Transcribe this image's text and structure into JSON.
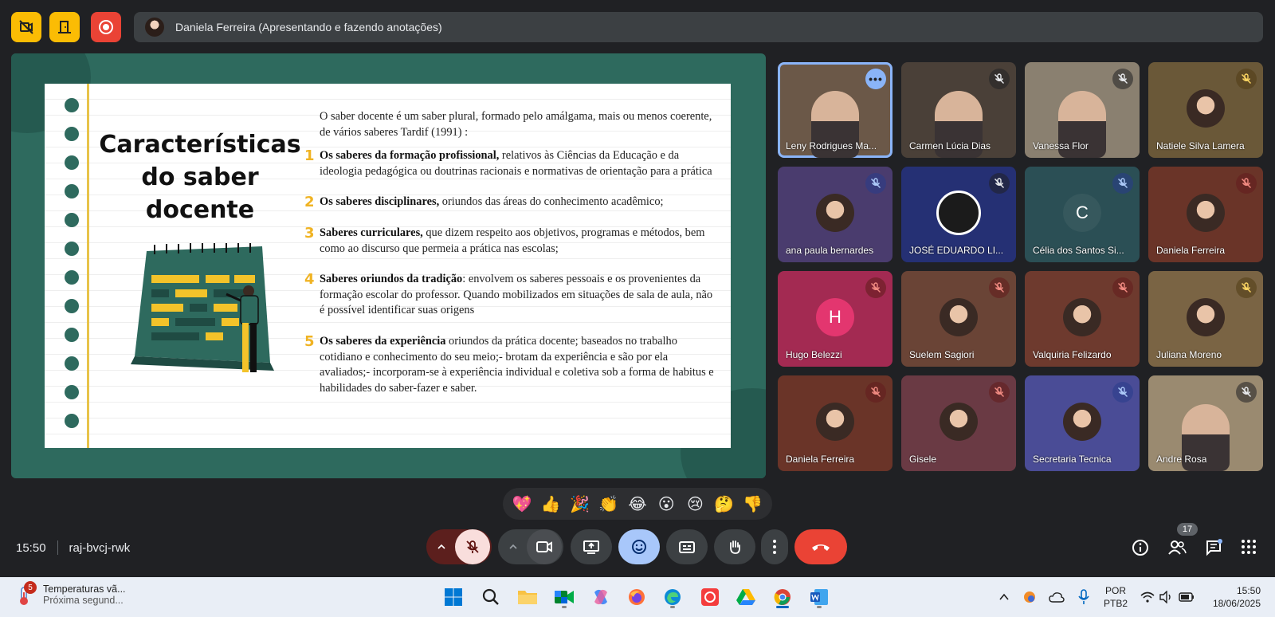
{
  "presenter_bar": {
    "label": "Daniela Ferreira (Apresentando e fazendo anotações)"
  },
  "slide": {
    "title_lines": [
      "Características",
      "do saber",
      "docente"
    ],
    "intro": "O saber docente é um saber plural, formado pelo amálgama, mais ou menos coerente, de vários saberes Tardif (1991) :",
    "items": [
      {
        "num": "1",
        "bold": "Os saberes da formação profissional,",
        "text": " relativos às Ciências da Educação e da ideologia pedagógica ou doutrinas racionais e normativas de orientação para a prática"
      },
      {
        "num": "2",
        "bold": "Os saberes disciplinares,",
        "text": " oriundos das áreas do conhecimento acadêmico;"
      },
      {
        "num": "3",
        "bold": " Saberes curriculares,",
        "text": " que dizem respeito aos objetivos, programas e métodos, bem como ao discurso que permeia a prática nas escolas;"
      },
      {
        "num": "4",
        "bold": "Saberes oriundos da tradição",
        "text": ": envolvem os saberes pessoais e os provenientes da formação escolar do professor. Quando mobilizados em situações de sala de aula, não é possível identificar suas origens"
      },
      {
        "num": "5",
        "bold": "Os saberes da experiência",
        "text": " oriundos da prática docente; baseados no trabalho cotidiano  e conhecimento do seu meio;- brotam da experiência e são por ela avaliados;- incorporam-se à experiência individual e coletiva sob a forma de habitus e habilidades do saber-fazer e saber."
      }
    ]
  },
  "participants": [
    {
      "name": "Leny Rodrigues Ma...",
      "bg": "#6b5848",
      "kind": "video",
      "mic": "more"
    },
    {
      "name": "Carmen Lúcia Dias",
      "bg": "#4a4038",
      "kind": "video",
      "mic": "dark"
    },
    {
      "name": "Vanessa Flor",
      "bg": "#8a8070",
      "kind": "video",
      "mic": "dark"
    },
    {
      "name": "Natiele Silva Lamera",
      "bg": "#6a5838",
      "kind": "photo",
      "mic": "yellowish"
    },
    {
      "name": "ana paula bernardes",
      "bg": "#4a3c6e",
      "kind": "photo",
      "mic": "blue"
    },
    {
      "name": "JOSÉ EDUARDO LI...",
      "bg": "#253074",
      "kind": "obs",
      "mic": "dark"
    },
    {
      "name": "Célia dos Santos Si...",
      "bg": "#2b4f55",
      "kind": "letter",
      "letter": "C",
      "mic": "blue"
    },
    {
      "name": "Daniela Ferreira",
      "bg": "#6a3428",
      "kind": "photo",
      "mic": "red"
    },
    {
      "name": "Hugo Belezzi",
      "bg": "#a32a52",
      "kind": "letter",
      "letter": "H",
      "mic": "red"
    },
    {
      "name": "Suelem Sagiori",
      "bg": "#6a4436",
      "kind": "photo",
      "mic": "red"
    },
    {
      "name": "Valquiria Felizardo",
      "bg": "#6e3a2e",
      "kind": "photo",
      "mic": "red"
    },
    {
      "name": "Juliana Moreno",
      "bg": "#7a6444",
      "kind": "photo",
      "mic": "yellowish"
    },
    {
      "name": "Daniela Ferreira",
      "bg": "#6a3428",
      "kind": "photo",
      "mic": "red"
    },
    {
      "name": "Gisele",
      "bg": "#6a3a44",
      "kind": "photo",
      "mic": "red"
    },
    {
      "name": "Secretaria Tecnica",
      "bg": "#4a4c96",
      "kind": "photo",
      "mic": "blue"
    },
    {
      "name": "Andre Rosa",
      "bg": "#9a8a70",
      "kind": "video",
      "mic": "dark"
    }
  ],
  "reactions": [
    "💖",
    "👍",
    "🎉",
    "👏",
    "😂",
    "😮",
    "😢",
    "🤔",
    "👎"
  ],
  "meeting": {
    "time": "15:50",
    "code": "raj-bvcj-rwk",
    "participant_count": "17"
  },
  "taskbar": {
    "weather_title": "Temperaturas vã...",
    "weather_sub": "Próxima segund...",
    "weather_badge": "5",
    "lang_1": "POR",
    "lang_2": "PTB2",
    "clock_time": "15:50",
    "clock_date": "18/06/2025"
  }
}
